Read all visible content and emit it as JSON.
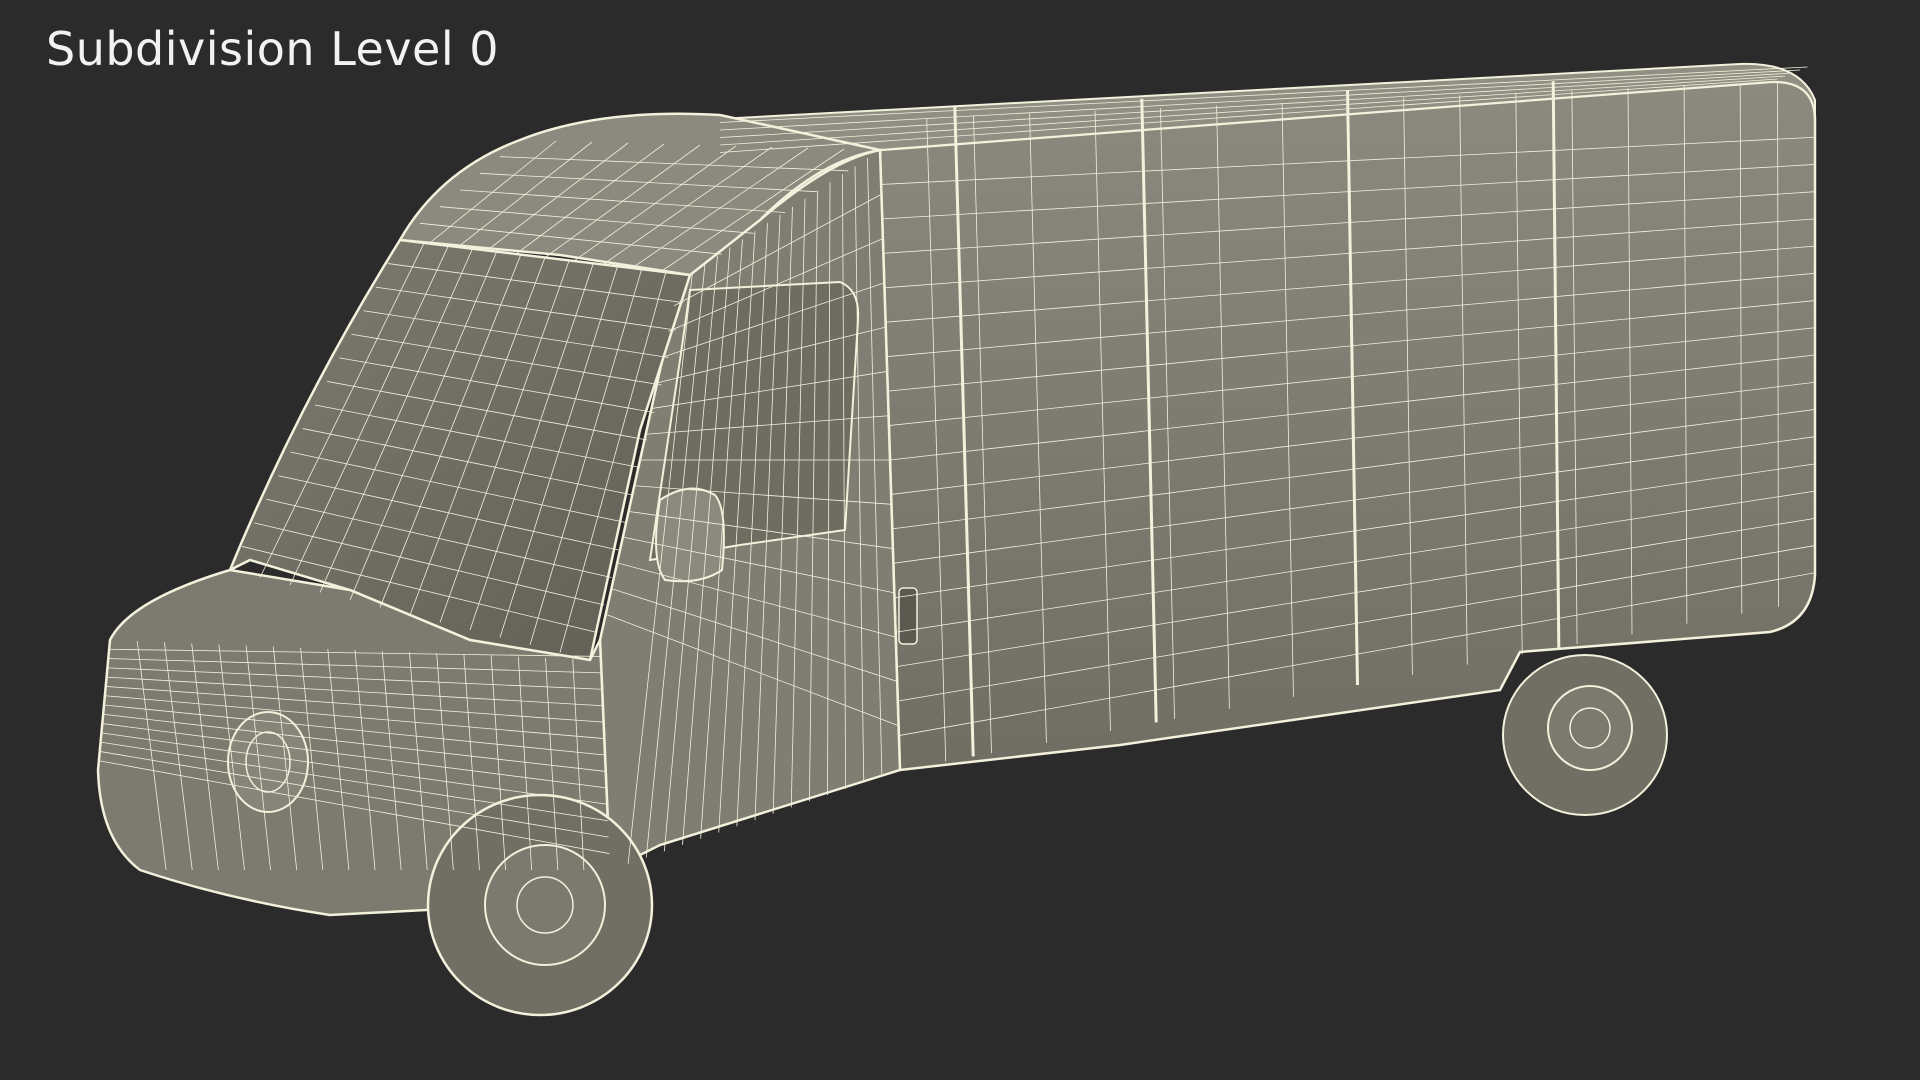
{
  "viewport": {
    "label": "Subdivision Level 0"
  },
  "render": {
    "subject": "van-wireframe-model",
    "background_color": "#2b2b2b",
    "body_color": "#7a7a6e",
    "wire_color": "#f3f0dc"
  }
}
